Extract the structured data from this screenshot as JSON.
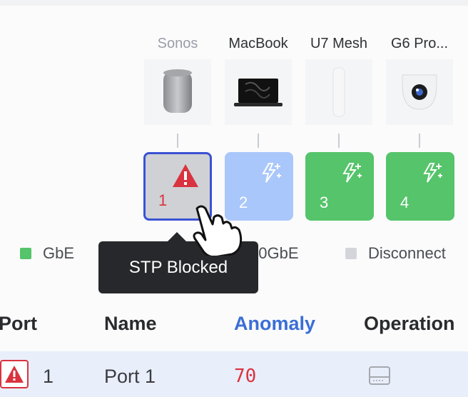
{
  "devices": [
    {
      "name": "Sonos",
      "icon": "speaker-icon",
      "dim": true
    },
    {
      "name": "MacBook",
      "icon": "laptop-icon",
      "dim": false
    },
    {
      "name": "U7 Mesh",
      "icon": "access-point-icon",
      "dim": false
    },
    {
      "name": "G6 Pro...",
      "icon": "camera-icon",
      "dim": false
    }
  ],
  "ports": [
    {
      "number": "1",
      "status": "blocked",
      "color": "#cfd1d5"
    },
    {
      "number": "2",
      "status": "10GbE",
      "color": "#a9c7fb"
    },
    {
      "number": "3",
      "status": "GbE",
      "color": "#55c46a"
    },
    {
      "number": "4",
      "status": "GbE",
      "color": "#55c46a"
    }
  ],
  "legend": [
    {
      "label": "GbE",
      "color": "#55c46a"
    },
    {
      "label": "10GbE",
      "color": "#a9c7fb"
    },
    {
      "label": "Disconnect",
      "color": "#d3d5d9"
    }
  ],
  "tooltip": {
    "text": "STP Blocked"
  },
  "table": {
    "headers": {
      "port": "Port",
      "name": "Name",
      "anomaly": "Anomaly",
      "operation": "Operation"
    },
    "rows": [
      {
        "port": "1",
        "name": "Port 1",
        "anomaly": "70",
        "operation_icon": "storage-icon"
      }
    ]
  },
  "colors": {
    "accent": "#3b6fd6",
    "alert": "#d9333f",
    "selected_border": "#3b52d4"
  }
}
